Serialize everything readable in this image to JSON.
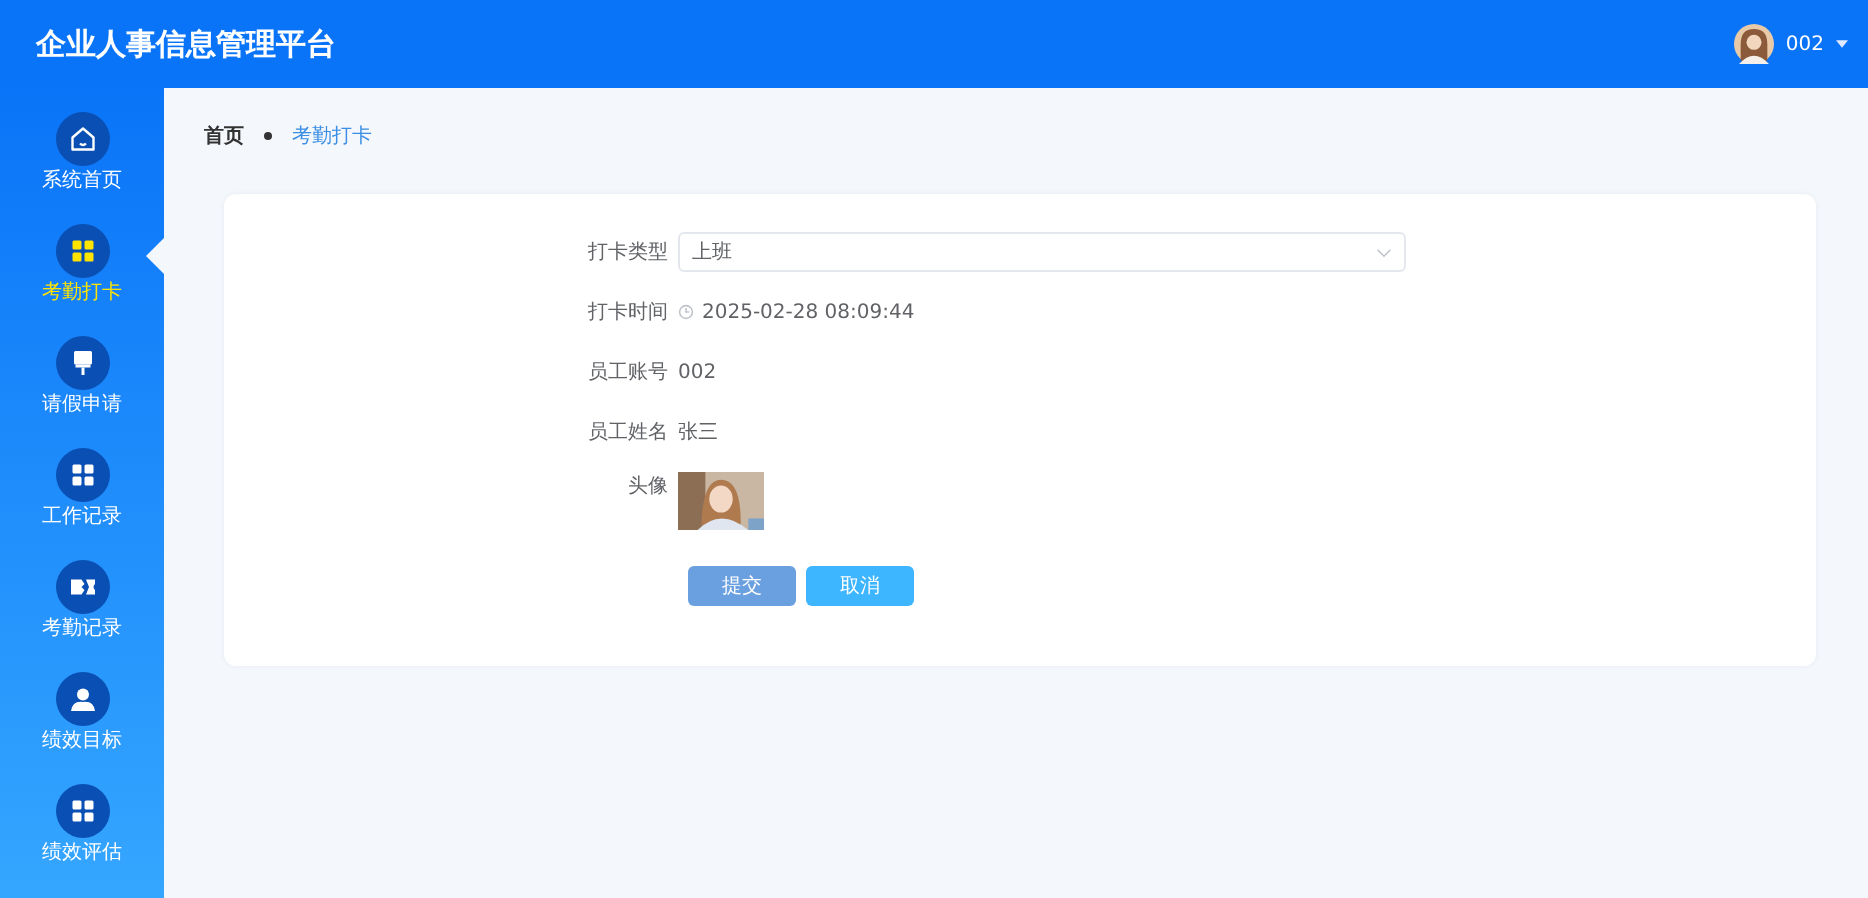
{
  "header": {
    "title": "企业人事信息管理平台",
    "user": {
      "name": "002"
    }
  },
  "sidebar": {
    "items": [
      {
        "label": "系统首页",
        "kind": "home",
        "selected": false
      },
      {
        "label": "考勤打卡",
        "kind": "grid",
        "selected": true
      },
      {
        "label": "请假申请",
        "kind": "brush",
        "selected": false
      },
      {
        "label": "工作记录",
        "kind": "grid",
        "selected": false
      },
      {
        "label": "考勤记录",
        "kind": "ticket",
        "selected": false
      },
      {
        "label": "绩效目标",
        "kind": "user",
        "selected": false
      },
      {
        "label": "绩效评估",
        "kind": "grid",
        "selected": false
      }
    ]
  },
  "breadcrumb": [
    "首页",
    "考勤打卡"
  ],
  "form": {
    "fields": [
      {
        "kind": "select",
        "label": "打卡类型",
        "value": "上班"
      },
      {
        "kind": "time",
        "label": "打卡时间",
        "value": "2025-02-28 08:09:44"
      },
      {
        "kind": "text",
        "label": "员工账号",
        "value": "002"
      },
      {
        "kind": "text",
        "label": "员工姓名",
        "value": "张三"
      },
      {
        "label": "头像"
      }
    ],
    "buttons": [
      {
        "label": "提交",
        "kind": "submit"
      },
      {
        "label": "取消",
        "kind": "cancel"
      }
    ]
  }
}
